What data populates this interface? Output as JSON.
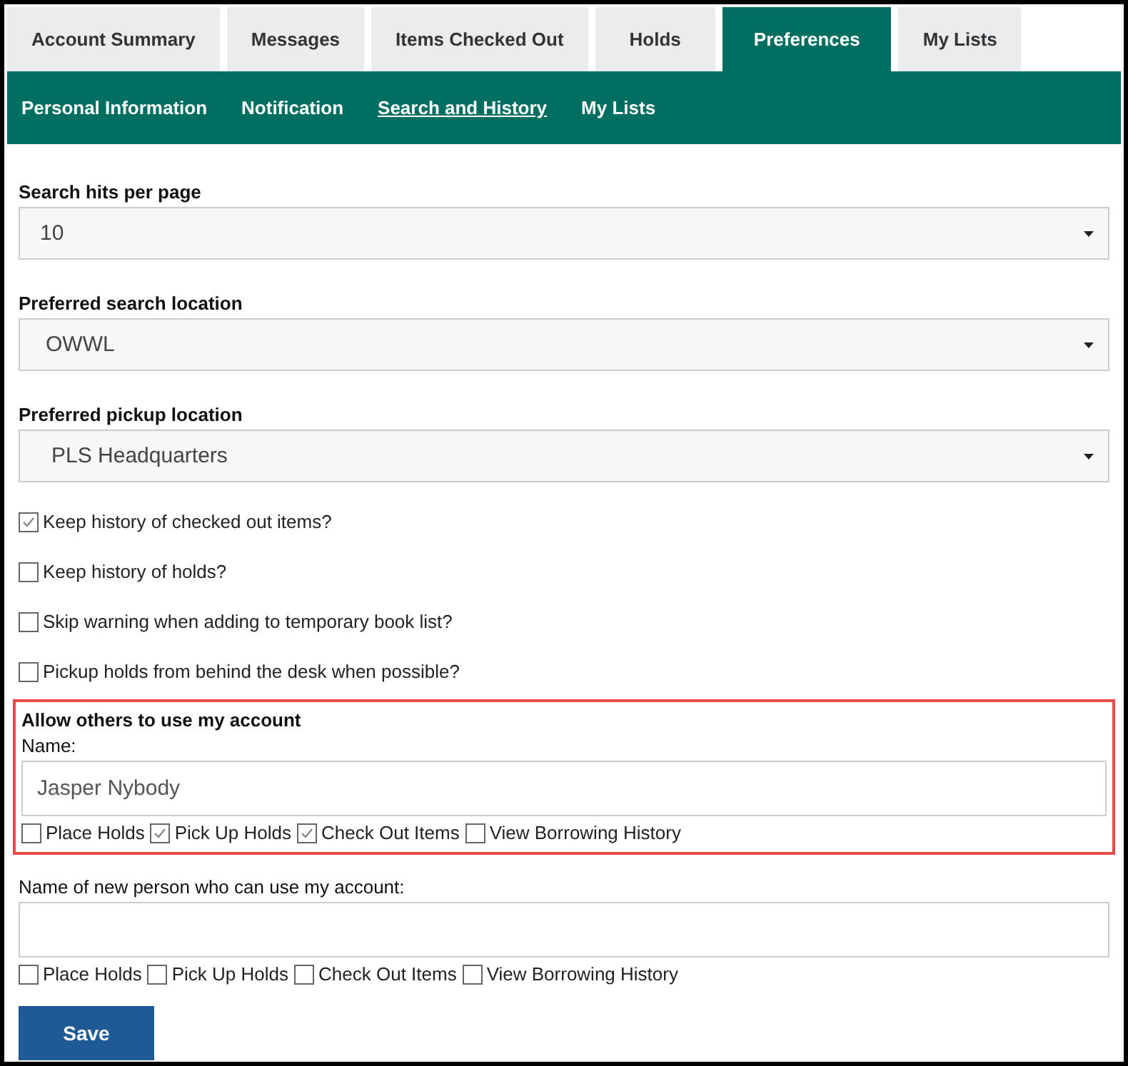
{
  "tabs": [
    {
      "label": "Account Summary",
      "selected": false
    },
    {
      "label": "Messages",
      "selected": false
    },
    {
      "label": "Items Checked Out",
      "selected": false
    },
    {
      "label": "Holds",
      "selected": false
    },
    {
      "label": "Preferences",
      "selected": true
    },
    {
      "label": "My Lists",
      "selected": false
    }
  ],
  "subnav": [
    {
      "label": "Personal Information",
      "selected": false
    },
    {
      "label": "Notification",
      "selected": false
    },
    {
      "label": "Search and History",
      "selected": true
    },
    {
      "label": "My Lists",
      "selected": false
    }
  ],
  "selects": [
    {
      "label": "Search hits per page",
      "value": "10"
    },
    {
      "label": "Preferred search location",
      "value": "OWWL"
    },
    {
      "label": "Preferred pickup location",
      "value": "PLS Headquarters"
    }
  ],
  "options": [
    {
      "label": "Keep history of checked out items?",
      "checked": true
    },
    {
      "label": "Keep history of holds?",
      "checked": false
    },
    {
      "label": "Skip warning when adding to temporary book list?",
      "checked": false
    },
    {
      "label": "Pickup holds from behind the desk when possible?",
      "checked": false
    }
  ],
  "shared_account": {
    "title": "Allow others to use my account",
    "highlighted": true,
    "name_label": "Name:",
    "name_value": "Jasper Nybody",
    "permissions": [
      {
        "label": "Place Holds",
        "checked": false
      },
      {
        "label": "Pick Up Holds",
        "checked": true
      },
      {
        "label": "Check Out Items",
        "checked": true
      },
      {
        "label": "View Borrowing History",
        "checked": false
      }
    ]
  },
  "new_person": {
    "label": "Name of new person who can use my account:",
    "permissions": [
      {
        "label": "Place Holds",
        "checked": false
      },
      {
        "label": "Pick Up Holds",
        "checked": false
      },
      {
        "label": "Check Out Items",
        "checked": false
      },
      {
        "label": "View Borrowing History",
        "checked": false
      }
    ]
  },
  "save_button": "Save"
}
